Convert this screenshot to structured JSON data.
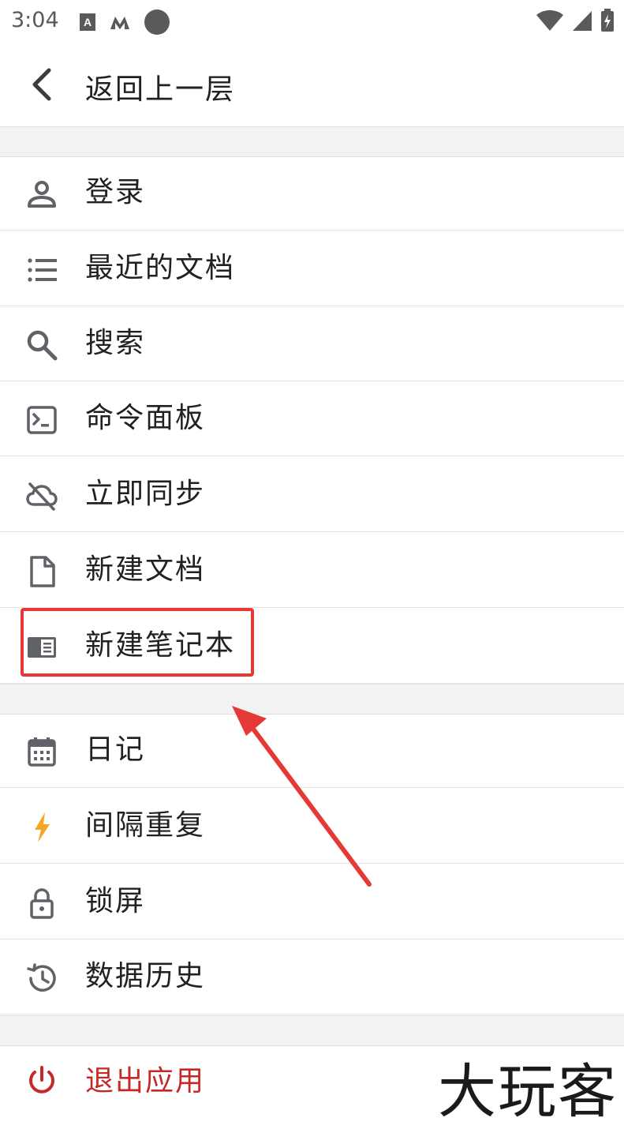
{
  "status_bar": {
    "time": "3:04"
  },
  "back": {
    "label": "返回上一层"
  },
  "group1": [
    {
      "label": "登录",
      "icon": "person-icon"
    },
    {
      "label": "最近的文档",
      "icon": "list-icon"
    },
    {
      "label": "搜索",
      "icon": "search-icon"
    },
    {
      "label": "命令面板",
      "icon": "terminal-icon"
    },
    {
      "label": "立即同步",
      "icon": "cloud-off-icon"
    },
    {
      "label": "新建文档",
      "icon": "file-icon"
    },
    {
      "label": "新建笔记本",
      "icon": "notebook-icon"
    }
  ],
  "group2": [
    {
      "label": "日记",
      "icon": "calendar-icon"
    },
    {
      "label": "间隔重复",
      "icon": "lightning-icon"
    },
    {
      "label": "锁屏",
      "icon": "lock-icon"
    },
    {
      "label": "数据历史",
      "icon": "history-icon"
    }
  ],
  "exit": {
    "label": "退出应用",
    "icon": "power-icon"
  },
  "watermark": "大玩客",
  "colors": {
    "icon": "#5f6368",
    "accent_lightning": "#f5a623",
    "exit_red": "#c62828",
    "highlight_red": "#e53935",
    "divider": "#e4e4e4",
    "gap_bg": "#f2f2f2"
  }
}
